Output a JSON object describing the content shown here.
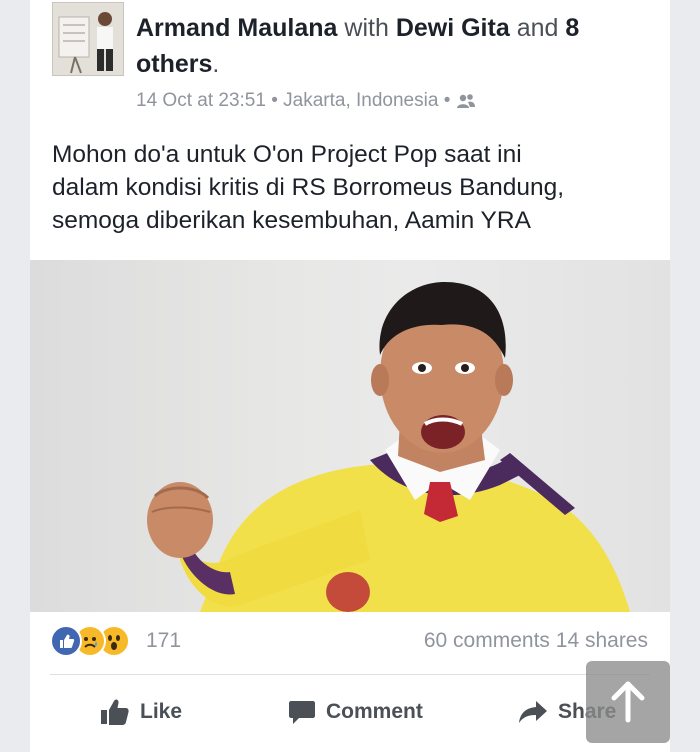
{
  "post": {
    "author": "Armand Maulana",
    "with_word": "with",
    "tagged": "Dewi Gita",
    "and_word": "and",
    "others_count": "8",
    "others_word": "others",
    "period": ".",
    "timestamp": "14 Oct at 23:51",
    "separator": "•",
    "location": "Jakarta, Indonesia",
    "text_line1": "Mohon do'a untuk O'on Project Pop saat ini",
    "text_line2": "dalam kondisi kritis di RS Borromeus Bandung,",
    "text_line3": "semoga diberikan kesembuhan, Aamin YRA"
  },
  "reactions": {
    "icons": [
      "like-icon",
      "sad-icon",
      "wow-icon"
    ],
    "count": "171",
    "comments": "60 comments",
    "shares": "14 shares"
  },
  "actions": {
    "like": "Like",
    "comment": "Comment",
    "share": "Share"
  },
  "colors": {
    "like_blue": "#4267b2",
    "reaction_yellow": "#f7b928",
    "text": "#1d2129",
    "muted": "#90949c",
    "shirt_yellow": "#f2e04a",
    "collar_purple": "#4b2a5e"
  }
}
